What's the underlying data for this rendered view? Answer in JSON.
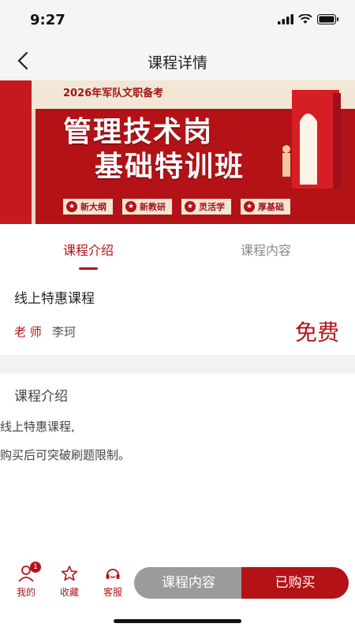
{
  "status": {
    "time": "9:27"
  },
  "nav": {
    "title": "课程详情"
  },
  "banner": {
    "tag": "2026年军队文职备考",
    "line1": "管理技术岗",
    "line2": "基础特训班",
    "features": [
      "新大纲",
      "新教研",
      "灵活学",
      "厚基础"
    ]
  },
  "tabs": {
    "intro": "课程介绍",
    "content": "课程内容"
  },
  "course": {
    "name": "线上特惠课程",
    "teacher_label": "老 师",
    "teacher": "李珂",
    "price": "免费"
  },
  "intro": {
    "title": "课程介绍",
    "lines": [
      "线上特惠课程,",
      "购买后可突破刷题限制。"
    ]
  },
  "bottom": {
    "mine": "我的",
    "mine_badge": "1",
    "favorite": "收藏",
    "service": "客服",
    "content_btn": "课程内容",
    "bought_btn": "已购买"
  },
  "colors": {
    "accent": "#b31216",
    "gray_button": "#9b9b9b"
  }
}
